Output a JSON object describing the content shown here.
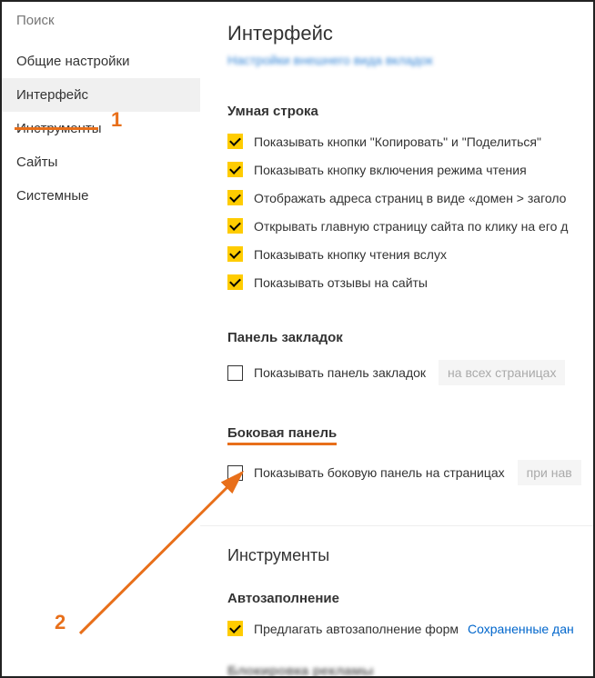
{
  "search": {
    "placeholder": "Поиск"
  },
  "nav": {
    "items": [
      {
        "label": "Общие настройки"
      },
      {
        "label": "Интерфейс"
      },
      {
        "label": "Инструменты"
      },
      {
        "label": "Сайты"
      },
      {
        "label": "Системные"
      }
    ],
    "active_index": 1
  },
  "page": {
    "title": "Интерфейс",
    "top_link": "Настройки внешнего вида вкладок"
  },
  "smart_line": {
    "title": "Умная строка",
    "options": [
      {
        "checked": true,
        "label": "Показывать кнопки \"Копировать\" и \"Поделиться\""
      },
      {
        "checked": true,
        "label": "Показывать кнопку включения режима чтения"
      },
      {
        "checked": true,
        "label": "Отображать адреса страниц в виде «домен > заголо"
      },
      {
        "checked": true,
        "label": "Открывать главную страницу сайта по клику на его д"
      },
      {
        "checked": true,
        "label": "Показывать кнопку чтения вслух"
      },
      {
        "checked": true,
        "label": "Показывать отзывы на сайты"
      }
    ]
  },
  "bookmarks_panel": {
    "title": "Панель закладок",
    "option": {
      "checked": false,
      "label": "Показывать панель закладок"
    },
    "dropdown": "на всех страницах"
  },
  "side_panel": {
    "title": "Боковая панель",
    "option": {
      "checked": false,
      "label": "Показывать боковую панель на страницах"
    },
    "dropdown": "при нав"
  },
  "tools": {
    "title": "Инструменты",
    "autofill": {
      "title": "Автозаполнение",
      "option": {
        "checked": true,
        "label": "Предлагать автозаполнение форм"
      },
      "link": "Сохраненные дан"
    },
    "blocking_title": "Блокировка рекламы"
  },
  "annotations": {
    "one": "1",
    "two": "2"
  }
}
